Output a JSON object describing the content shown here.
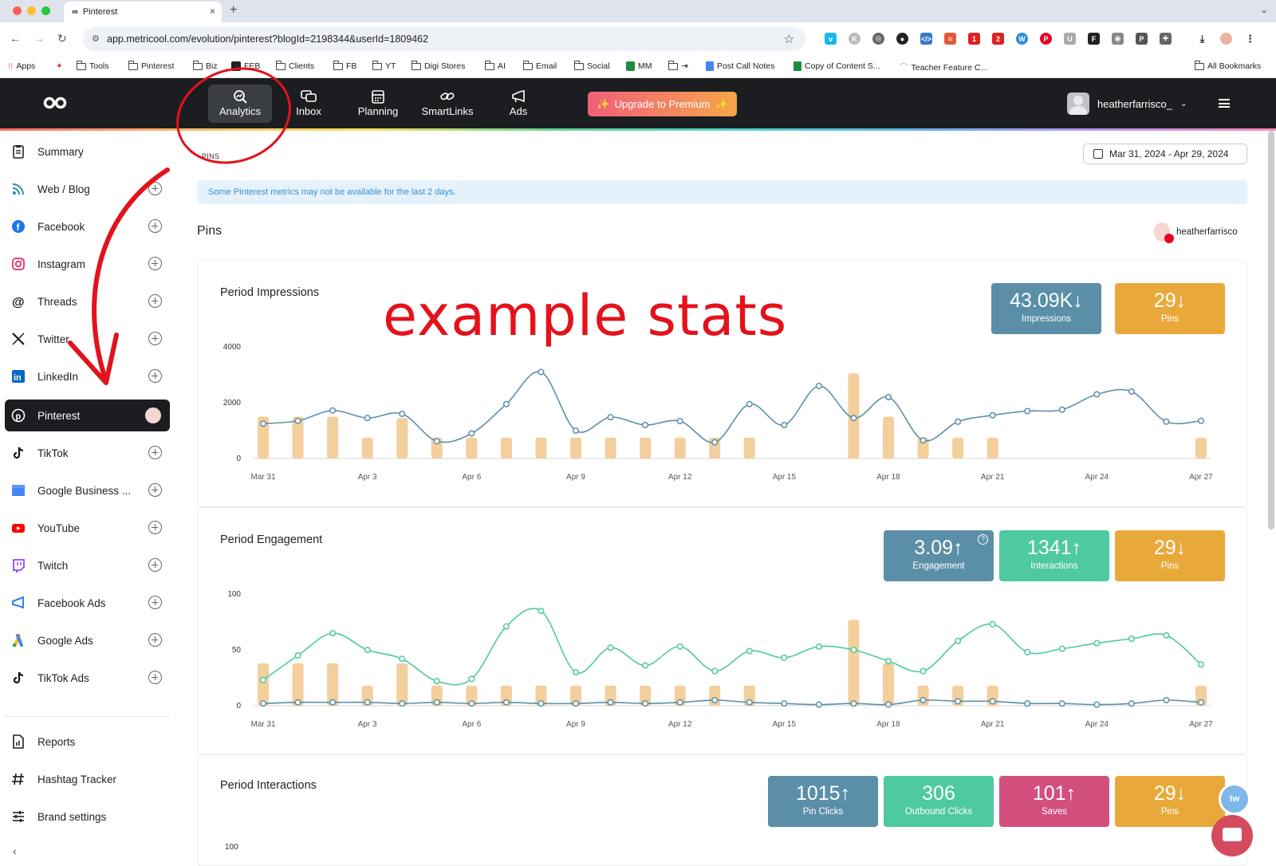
{
  "browser": {
    "tab_title": "Pinterest",
    "tab_close": "×",
    "new_tab": "+",
    "tab_menu": "⌄",
    "url": "app.metricool.com/evolution/pinterest?blogId=2198344&userId=1809462",
    "bookmarks": [
      "Apps",
      "Tools",
      "Pinterest",
      "Biz",
      "FEB",
      "Clients",
      "FB",
      "YT",
      "Digi Stores",
      "AI",
      "Email",
      "Social",
      "MM",
      "",
      "Post Call Notes",
      "Copy of Content S...",
      "Teacher Feature C...",
      "All Bookmarks"
    ]
  },
  "appbar": {
    "nav": [
      {
        "label": "Analytics",
        "icon": "analytics-icon"
      },
      {
        "label": "Inbox",
        "icon": "inbox-icon"
      },
      {
        "label": "Planning",
        "icon": "calendar-icon"
      },
      {
        "label": "SmartLinks",
        "icon": "link-icon"
      },
      {
        "label": "Ads",
        "icon": "megaphone-icon"
      }
    ],
    "premium_label": "Upgrade to Premium",
    "username": "heatherfarrisco_"
  },
  "sidebar": {
    "items": [
      {
        "label": "Summary",
        "icon": "clipboard-icon",
        "plus": false
      },
      {
        "label": "Web / Blog",
        "icon": "rss-icon",
        "plus": true
      },
      {
        "label": "Facebook",
        "icon": "facebook-icon",
        "plus": true
      },
      {
        "label": "Instagram",
        "icon": "instagram-icon",
        "plus": true
      },
      {
        "label": "Threads",
        "icon": "threads-icon",
        "plus": true
      },
      {
        "label": "Twitter",
        "icon": "x-icon",
        "plus": true
      },
      {
        "label": "LinkedIn",
        "icon": "linkedin-icon",
        "plus": true
      },
      {
        "label": "Pinterest",
        "icon": "pinterest-icon",
        "plus": false,
        "active": true
      },
      {
        "label": "TikTok",
        "icon": "tiktok-icon",
        "plus": true
      },
      {
        "label": "Google Business ...",
        "icon": "google-business-icon",
        "plus": true
      },
      {
        "label": "YouTube",
        "icon": "youtube-icon",
        "plus": true
      },
      {
        "label": "Twitch",
        "icon": "twitch-icon",
        "plus": true
      },
      {
        "label": "Facebook Ads",
        "icon": "megaphone-icon",
        "plus": true
      },
      {
        "label": "Google Ads",
        "icon": "google-ads-icon",
        "plus": true
      },
      {
        "label": "TikTok Ads",
        "icon": "tiktok-icon",
        "plus": true
      }
    ],
    "bottom": [
      {
        "label": "Reports",
        "icon": "report-icon"
      },
      {
        "label": "Hashtag Tracker",
        "icon": "hashtag-icon"
      },
      {
        "label": "Brand settings",
        "icon": "sliders-icon"
      }
    ],
    "collapse": "‹"
  },
  "main": {
    "breadcrumb": "PINS",
    "date_range": "Mar 31, 2024 - Apr 29, 2024",
    "notice": "Some Pinterest metrics may not be available for the last 2 days.",
    "title": "Pins",
    "owner": "heatherfarrisco"
  },
  "annotation": {
    "text": "example stats"
  },
  "cards": {
    "impressions": {
      "title": "Period Impressions",
      "stats": [
        {
          "value": "43.09K",
          "arrow": "↓",
          "label": "Impressions",
          "color": "#5b8fa8"
        },
        {
          "value": "29",
          "arrow": "↓",
          "label": "Pins",
          "color": "#e9a93a"
        }
      ]
    },
    "engagement": {
      "title": "Period Engagement",
      "help": "?",
      "stats": [
        {
          "value": "3.09",
          "arrow": "↑",
          "label": "Engagement",
          "color": "#5b8fa8"
        },
        {
          "value": "1341",
          "arrow": "↑",
          "label": "Interactions",
          "color": "#4ec9a0"
        },
        {
          "value": "29",
          "arrow": "↓",
          "label": "Pins",
          "color": "#e9a93a"
        }
      ]
    },
    "interactions": {
      "title": "Period Interactions",
      "stats": [
        {
          "value": "1015",
          "arrow": "↑",
          "label": "Pin Clicks",
          "color": "#5b8fa8"
        },
        {
          "value": "306",
          "arrow": "",
          "label": "Outbound Clicks",
          "color": "#4ec9a0"
        },
        {
          "value": "101",
          "arrow": "↑",
          "label": "Saves",
          "color": "#d24f7e"
        },
        {
          "value": "29",
          "arrow": "↓",
          "label": "Pins",
          "color": "#e9a93a"
        }
      ],
      "first_tick": "100"
    }
  },
  "chart_data": [
    {
      "type": "line",
      "title": "Period Impressions",
      "x": [
        "Mar 31",
        "Apr 1",
        "Apr 2",
        "Apr 3",
        "Apr 4",
        "Apr 5",
        "Apr 6",
        "Apr 7",
        "Apr 8",
        "Apr 9",
        "Apr 10",
        "Apr 11",
        "Apr 12",
        "Apr 13",
        "Apr 14",
        "Apr 15",
        "Apr 16",
        "Apr 17",
        "Apr 18",
        "Apr 19",
        "Apr 20",
        "Apr 21",
        "Apr 22",
        "Apr 23",
        "Apr 24",
        "Apr 25",
        "Apr 26",
        "Apr 27"
      ],
      "x_tick_labels": [
        "Mar 31",
        "Apr 3",
        "Apr 6",
        "Apr 9",
        "Apr 12",
        "Apr 15",
        "Apr 18",
        "Apr 21",
        "Apr 24",
        "Apr 27"
      ],
      "y_ticks": [
        "0",
        "2000",
        "4000"
      ],
      "ylim": [
        0,
        4000
      ],
      "series": [
        {
          "kind": "line",
          "color": "#5b8fa8",
          "values": [
            1250,
            1350,
            1720,
            1450,
            1600,
            620,
            900,
            1950,
            3100,
            1000,
            1480,
            1200,
            1340,
            580,
            1950,
            1200,
            2600,
            1450,
            2200,
            650,
            1320,
            1550,
            1700,
            1750,
            2300,
            2400,
            1320,
            1350
          ]
        },
        {
          "kind": "bar",
          "color": "#f3cf9c",
          "values": [
            1500,
            1500,
            1500,
            750,
            1450,
            750,
            750,
            750,
            750,
            750,
            750,
            750,
            750,
            750,
            750,
            null,
            null,
            3050,
            1500,
            750,
            750,
            750,
            null,
            null,
            null,
            null,
            null,
            750
          ]
        }
      ]
    },
    {
      "type": "line",
      "title": "Period Engagement",
      "x": [
        "Mar 31",
        "Apr 1",
        "Apr 2",
        "Apr 3",
        "Apr 4",
        "Apr 5",
        "Apr 6",
        "Apr 7",
        "Apr 8",
        "Apr 9",
        "Apr 10",
        "Apr 11",
        "Apr 12",
        "Apr 13",
        "Apr 14",
        "Apr 15",
        "Apr 16",
        "Apr 17",
        "Apr 18",
        "Apr 19",
        "Apr 20",
        "Apr 21",
        "Apr 22",
        "Apr 23",
        "Apr 24",
        "Apr 25",
        "Apr 26",
        "Apr 27"
      ],
      "x_tick_labels": [
        "Mar 31",
        "Apr 3",
        "Apr 6",
        "Apr 9",
        "Apr 12",
        "Apr 15",
        "Apr 18",
        "Apr 21",
        "Apr 24",
        "Apr 27"
      ],
      "y_ticks": [
        "0",
        "50",
        "100"
      ],
      "ylim": [
        0,
        100
      ],
      "series": [
        {
          "kind": "line",
          "color": "#4ec9a0",
          "values": [
            23,
            45,
            65,
            50,
            42,
            22,
            24,
            71,
            85,
            30,
            52,
            36,
            53,
            31,
            49,
            43,
            53,
            50,
            40,
            31,
            58,
            73,
            48,
            51,
            56,
            60,
            63,
            37
          ]
        },
        {
          "kind": "line",
          "color": "#5b8fa8",
          "values": [
            2,
            3,
            3,
            3,
            2,
            3,
            2,
            3,
            2,
            2,
            3,
            2,
            3,
            5,
            3,
            2,
            1,
            2,
            1,
            5,
            4,
            4,
            2,
            2,
            1,
            2,
            5,
            3
          ]
        },
        {
          "kind": "bar",
          "color": "#f3cf9c",
          "values": [
            38,
            38,
            38,
            18,
            38,
            18,
            18,
            18,
            18,
            18,
            18,
            18,
            18,
            18,
            18,
            null,
            null,
            77,
            38,
            18,
            18,
            18,
            null,
            null,
            null,
            null,
            null,
            18
          ]
        }
      ]
    }
  ]
}
